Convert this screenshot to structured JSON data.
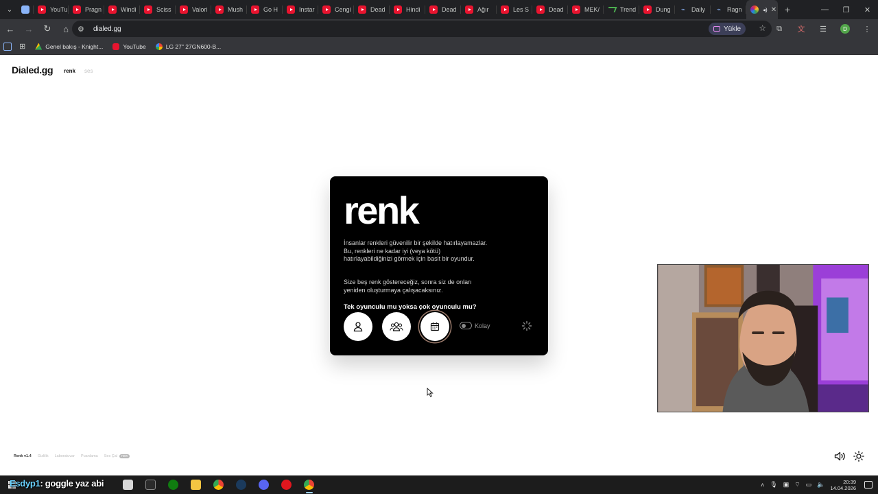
{
  "browser": {
    "tabs": [
      {
        "label": "YouTu",
        "icon": "youtube-icon"
      },
      {
        "label": "Pragn",
        "icon": "youtube-icon"
      },
      {
        "label": "Windi",
        "icon": "youtube-icon"
      },
      {
        "label": "Sciss",
        "icon": "youtube-icon"
      },
      {
        "label": "Valori",
        "icon": "youtube-icon"
      },
      {
        "label": "Mush",
        "icon": "youtube-icon"
      },
      {
        "label": "Go H",
        "icon": "youtube-icon"
      },
      {
        "label": "Instar",
        "icon": "youtube-icon"
      },
      {
        "label": "Cengi",
        "icon": "youtube-icon"
      },
      {
        "label": "Dead",
        "icon": "youtube-icon"
      },
      {
        "label": "Hindi",
        "icon": "youtube-icon"
      },
      {
        "label": "Dead",
        "icon": "youtube-icon"
      },
      {
        "label": "Ağır",
        "icon": "youtube-icon"
      },
      {
        "label": "Les S",
        "icon": "youtube-icon"
      },
      {
        "label": "Dead",
        "icon": "youtube-icon"
      },
      {
        "label": "MEK/",
        "icon": "youtube-icon"
      },
      {
        "label": "Trend",
        "icon": "trends-icon"
      },
      {
        "label": "Dung",
        "icon": "youtube-icon"
      },
      {
        "label": "Daily",
        "icon": "twitch-icon"
      },
      {
        "label": "Ragn",
        "icon": "twitch-icon"
      }
    ],
    "active_tab": {
      "icon": "dialed-icon"
    },
    "address": "dialed.gg",
    "install_label": "Yükle",
    "bookmarks": [
      {
        "label": "Genel bakış - Knight...",
        "icon": "google-ads-icon"
      },
      {
        "label": "YouTube",
        "icon": "youtube-icon"
      },
      {
        "label": "LG 27\" 27GN600-B...",
        "icon": "google-icon"
      }
    ]
  },
  "page": {
    "logo": "Dialed.gg",
    "nav": {
      "active": "renk",
      "inactive": "ses"
    },
    "card": {
      "title": "renk",
      "paragraph1": "İnsanlar renkleri güvenilir bir şekilde hatırlayamazlar. Bu, renkleri ne kadar iyi (veya kötü) hatırlayabildiğinizi görmek için basit bir oyundur.",
      "paragraph2": "Size beş renk göstereceğiz, sonra siz de onları yeniden oluşturmaya çalışacaksınız.",
      "question": "Tek oyunculu mu yoksa çok oyunculu mu?",
      "toggle_label": "Kolay"
    },
    "footer": {
      "version": "Renk v1.4",
      "links": [
        "Gizlilik",
        "Laboratuvar",
        "Puanlama",
        "Ses Çal"
      ],
      "badge": "new"
    }
  },
  "taskbar": {
    "chat_nick": "Esdyp1",
    "chat_message": ": goggle yaz abi",
    "time": "20:39",
    "date": "14.04.2026"
  },
  "colors": {
    "card_bg": "#000000",
    "chrome_bg": "#202124",
    "toolbar_bg": "#35363a",
    "taskbar_bg": "#1c1c1c"
  }
}
